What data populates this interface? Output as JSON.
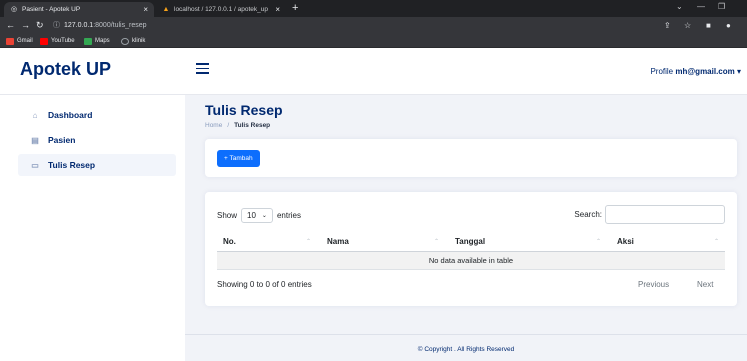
{
  "browser": {
    "tabs": [
      {
        "title": "Pasient - Apotek UP",
        "active": true
      },
      {
        "title": "localhost / 127.0.0.1 / apotek_up",
        "active": false
      }
    ],
    "new_tab_symbol": "+",
    "close_symbol": "×",
    "url_host": "127.0.0.1",
    "url_rest": ":8000/tulis_resep",
    "bookmarks": [
      {
        "label": "Gmail",
        "color": "#ea4335"
      },
      {
        "label": "YouTube",
        "color": "#ff0000"
      },
      {
        "label": "Maps",
        "color": "#34a853"
      },
      {
        "label": "klinik",
        "color": "#9aa0a6"
      }
    ]
  },
  "header": {
    "brand": "Apotek UP",
    "profile_label": "Profile",
    "profile_email": "mh@gmail.com"
  },
  "sidebar": {
    "items": [
      {
        "label": "Dashboard",
        "icon": "home-icon",
        "active": false
      },
      {
        "label": "Pasien",
        "icon": "clipboard-icon",
        "active": false
      },
      {
        "label": "Tulis Resep",
        "icon": "document-icon",
        "active": true
      }
    ]
  },
  "main": {
    "title": "Tulis Resep",
    "breadcrumb": {
      "home": "Home",
      "separator": "/",
      "current": "Tulis Resep"
    },
    "add_button": "+ Tambah",
    "table": {
      "show_label": "Show",
      "entries_value": "10",
      "entries_label": "entries",
      "search_label": "Search:",
      "columns": [
        "No.",
        "Nama",
        "Tanggal",
        "Aksi"
      ],
      "empty_message": "No data available in table",
      "info": "Showing 0 to 0 of 0 entries",
      "previous": "Previous",
      "next": "Next"
    }
  },
  "footer": {
    "text": "© Copyright . All Rights Reserved"
  },
  "colors": {
    "brand": "#012970",
    "primary": "#0d6efd",
    "background": "#f1f3f8"
  }
}
